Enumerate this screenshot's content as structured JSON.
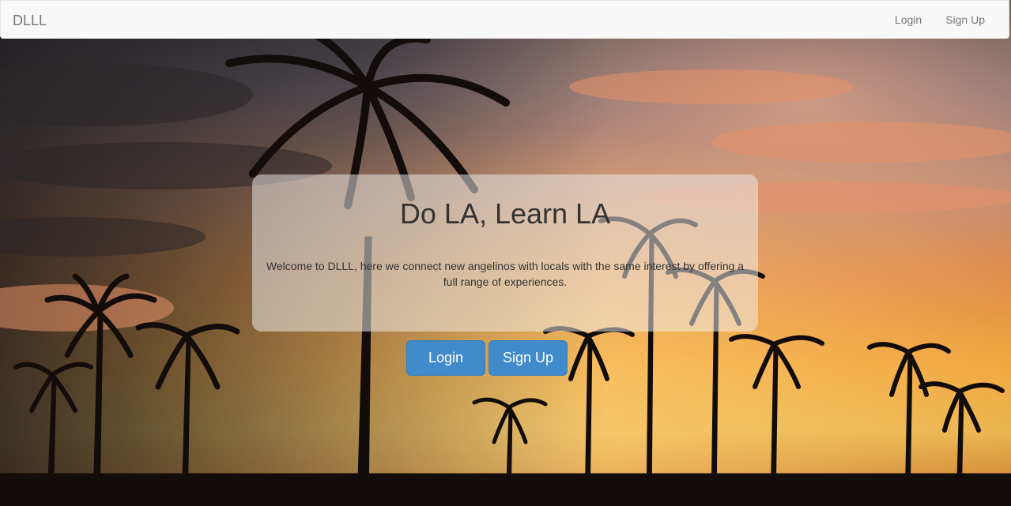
{
  "navbar": {
    "brand": "DLLL",
    "links": [
      {
        "label": "Login"
      },
      {
        "label": "Sign Up"
      }
    ]
  },
  "hero": {
    "title": "Do LA, Learn LA",
    "description": "Welcome to DLLL, here we connect new angelinos with locals with the same interest by offering a full range of experiences.",
    "buttons": {
      "login_label": "Login",
      "signup_label": "Sign Up"
    },
    "background_image": "sunset-palm-trees-image"
  },
  "colors": {
    "primary_button": "#428bca",
    "navbar_bg": "#f8f8f8",
    "navbar_text": "#777777",
    "heading_text": "#333333"
  }
}
